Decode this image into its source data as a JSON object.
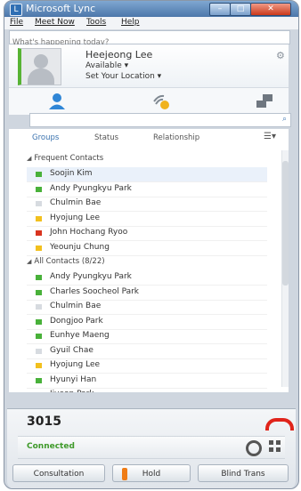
{
  "window": {
    "title": "Microsoft Lync",
    "controls": [
      "–",
      "□",
      "✕"
    ]
  },
  "menu": [
    "File",
    "Meet Now",
    "Tools",
    "Help"
  ],
  "status_message": {
    "placeholder": "What's happening today?"
  },
  "profile": {
    "name": "Heejeong Lee",
    "availability": "Available ▾",
    "location": "Set Your Location ▾",
    "status_color": "#57b334"
  },
  "view_tabs": [
    "Groups",
    "Status",
    "Relationship"
  ],
  "groups": [
    {
      "title": "Frequent Contacts",
      "contacts": [
        {
          "name": "Soojin Kim",
          "color": "#49b13a"
        },
        {
          "name": "Andy Pyungkyu Park",
          "color": "#49b13a"
        },
        {
          "name": "Chulmin Bae",
          "color": "#d7dbe0"
        },
        {
          "name": "Hyojung Lee",
          "color": "#f2c01e"
        },
        {
          "name": "John Hochang Ryoo",
          "color": "#d9341f"
        },
        {
          "name": "Yeounju Chung",
          "color": "#f2c01e"
        }
      ]
    },
    {
      "title": "All Contacts (8/22)",
      "contacts": [
        {
          "name": "Andy Pyungkyu Park",
          "color": "#49b13a"
        },
        {
          "name": "Charles Soocheol Park",
          "color": "#49b13a"
        },
        {
          "name": "Chulmin Bae",
          "color": "#d7dbe0"
        },
        {
          "name": "Dongjoo Park",
          "color": "#49b13a"
        },
        {
          "name": "Eunhye Maeng",
          "color": "#49b13a"
        },
        {
          "name": "Gyuil Chae",
          "color": "#d7dbe0"
        },
        {
          "name": "Hyojung Lee",
          "color": "#f2c01e"
        },
        {
          "name": "Hyunyi Han",
          "color": "#49b13a"
        },
        {
          "name": "Jiyeon Park",
          "color": "#d7dbe0"
        }
      ]
    }
  ],
  "call": {
    "number": "3015",
    "status": "Connected",
    "buttons": {
      "consultation": "Consultation",
      "hold": "Hold",
      "blind_transfer": "Blind Trans"
    }
  }
}
